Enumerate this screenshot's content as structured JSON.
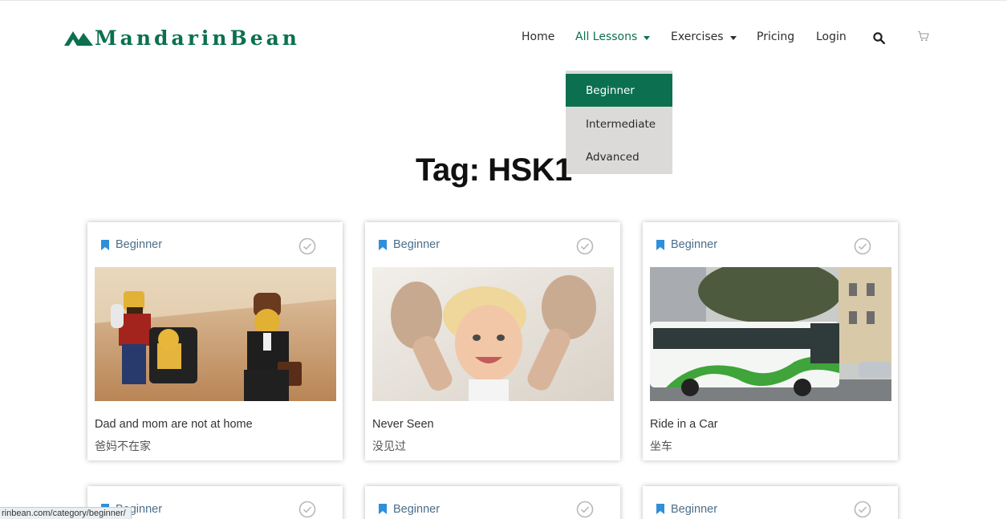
{
  "brand": {
    "name": "MandarinBean",
    "color": "#0c7050"
  },
  "nav": {
    "items": [
      {
        "label": "Home",
        "has_caret": false,
        "active": false
      },
      {
        "label": "All Lessons",
        "has_caret": true,
        "active": true
      },
      {
        "label": "Exercises",
        "has_caret": true,
        "active": false
      },
      {
        "label": "Pricing",
        "has_caret": false,
        "active": false
      },
      {
        "label": "Login",
        "has_caret": false,
        "active": false
      }
    ],
    "search_icon": "search-icon",
    "cart_icon": "cart-icon"
  },
  "dropdown": {
    "items": [
      {
        "label": "Beginner",
        "active": true
      },
      {
        "label": "Intermediate",
        "active": false
      },
      {
        "label": "Advanced",
        "active": false
      }
    ]
  },
  "page": {
    "title": "Tag: HSK1"
  },
  "cards": [
    {
      "category": "Beginner",
      "title": "Dad and mom are not at home",
      "subtitle": "爸妈不在家",
      "image": "lego-family-photo"
    },
    {
      "category": "Beginner",
      "title": "Never Seen",
      "subtitle": "没见过",
      "image": "child-sandy-hands-photo"
    },
    {
      "category": "Beginner",
      "title": "Ride in a Car",
      "subtitle": "坐车",
      "image": "city-bus-photo"
    },
    {
      "category": "Beginner",
      "title": "",
      "subtitle": "",
      "image": ""
    },
    {
      "category": "Beginner",
      "title": "",
      "subtitle": "",
      "image": ""
    },
    {
      "category": "Beginner",
      "title": "",
      "subtitle": "",
      "image": ""
    }
  ],
  "status_bar": {
    "url": "rinbean.com/category/beginner/"
  },
  "colors": {
    "accent": "#0c7050",
    "category_text": "#4b6e8a",
    "bookmark": "#2f8fd8",
    "dropdown_bg": "#dcd9d9"
  }
}
